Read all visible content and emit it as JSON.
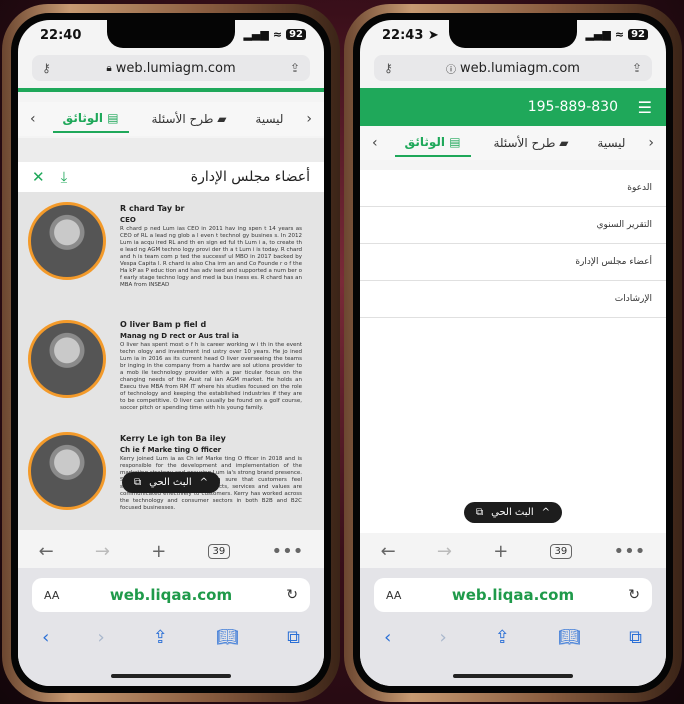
{
  "left": {
    "status_time": "22:40",
    "signal": "..ll",
    "wifi": "≈",
    "battery": "92",
    "url": "web.lumiagm.com",
    "tabs": {
      "prev": "‹",
      "active": "الوثائق",
      "questions": "طرح الأسئلة",
      "main": "ليسية",
      "next": "›"
    },
    "doc_title": "أعضاء مجلس الإدارة",
    "people": [
      {
        "name": "R chard Tay br",
        "role": "CEO",
        "bio": "R chard p ned Lum ias CEO in 2011 hav ing spen t 14 years as CEO of RL a lead ng glob a l even t technol gy busines s. In 2012 Lum ia acqu ired RL and th en sign ed ful th Lum i a, to create th e lead ng AGM techno logy provi der th a t Lum i is today. R chard and h is team com p ted the successf ul MBO in 2017 backed by Vespa Capita l. R chard is also Cha irm an and Co Founde r o f the Ha kP as P educ tion and has adv ised and supported a num ber o f early stage techno logy and med ia bus iness es. R chard has an MBA from INSEAD"
      },
      {
        "name": "O liver Bam p fiel d",
        "role": "Manag ng D rect or Aus tral ia",
        "bio": "O liver has spent most o f h is career working w i th in the event techn ology and investment ind ustry over 10 years. He jo ined Lum ia in 2016 as its current head O liver overseeing the teams br inging in the company from a hardw are sol utions provider to a mob ile technology provider with a par ticular focus on the changing needs of the Aust ral ian AGM market. He holds an Execu tive MBA from RM IT where his studies focused on the role of technology and keeping the established industries if they are to be competitive. O liver can usually be found on a golf course, soccer pitch or spending time with his young family."
      },
      {
        "name": "Kerry Le igh ton Ba iley",
        "role": "Ch ie f Marke ting O fficer",
        "bio": "Kerry joined Lum ia as Ch ief Marke ting O fficer in 2018 and is responsible for the development and implementation of the marketing strategy and ensuring Lum ia's strong brand presence. She is passionate about making sure that customers feel supported and that Lum ia products, services and values are communicated effectively to customers. Kerry has worked across the technology and consumer sectors in both B2B and B2C focused businesses."
      }
    ],
    "live_label": "البث الحي",
    "live_caret": "^",
    "page_count": "39",
    "safari_url": "web.liqaa.com",
    "aa": "AA"
  },
  "right": {
    "status_time": "22:43",
    "battery": "92",
    "url": "web.lumiagm.com",
    "phone_number": "195-889-830",
    "menu": [
      "الدعوة",
      "التقرير السنوي",
      "أعضاء مجلس الإدارة",
      "الإرشادات"
    ],
    "live_label": "البث الحي",
    "page_count": "39",
    "safari_url": "web.liqaa.com",
    "aa": "AA"
  },
  "colors": {
    "brand_green": "#1fa85a",
    "accent_orange": "#f39a2a"
  }
}
